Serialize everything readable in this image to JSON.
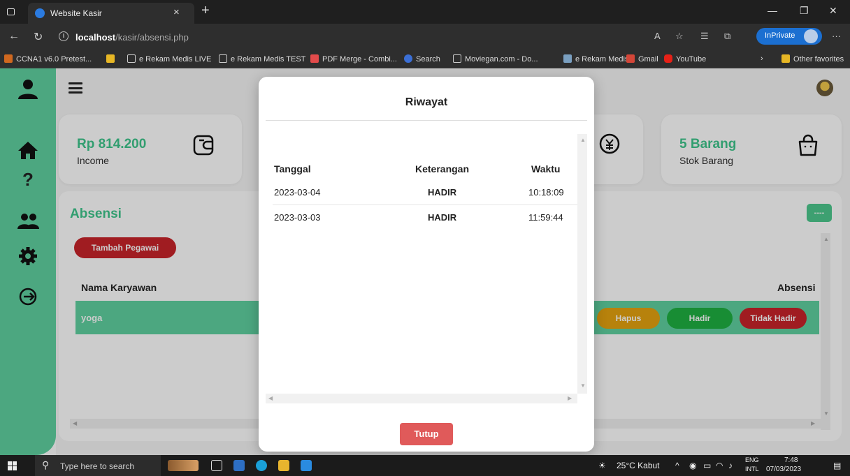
{
  "browser": {
    "tab_title": "Website Kasir",
    "tab_close": "×",
    "new_tab": "+",
    "url_host": "localhost",
    "url_path": "/kasir/absensi.php",
    "inprivate_label": "InPrivate",
    "bookmarks": [
      "CCNA1 v6.0 Pretest...",
      "e Rekam Medis LIVE",
      "e Rekam Medis TEST",
      "PDF Merge - Combi...",
      "Search",
      "Moviegan.com - Do...",
      "e Rekam Medis",
      "Gmail",
      "YouTube"
    ],
    "other_favorites": "Other favorites"
  },
  "cards": [
    {
      "value": "Rp 814.200",
      "label": "Income"
    },
    {
      "value": "5 Barang",
      "label": "Stok Barang"
    }
  ],
  "panel": {
    "title": "Absensi",
    "add_button": "Tambah Pegawai",
    "dash_button": "----",
    "col_name": "Nama Karyawan",
    "col_absensi": "Absensi",
    "row_name": "yoga",
    "btn_hapus": "Hapus",
    "btn_hadir": "Hadir",
    "btn_tidak_hadir": "Tidak Hadir"
  },
  "modal": {
    "title": "Riwayat",
    "headers": {
      "tanggal": "Tanggal",
      "keterangan": "Keterangan",
      "waktu": "Waktu"
    },
    "rows": [
      {
        "tanggal": "2023-03-04",
        "keterangan": "HADIR",
        "waktu": "10:18:09"
      },
      {
        "tanggal": "2023-03-03",
        "keterangan": "HADIR",
        "waktu": "11:59:44"
      }
    ],
    "close_button": "Tutup"
  },
  "taskbar": {
    "search_placeholder": "Type here to search",
    "weather": "25°C Kabut",
    "lang_top": "ENG",
    "lang_bottom": "INTL",
    "time": "7:48",
    "date": "07/03/2023"
  },
  "colors": {
    "accent_green": "#5fd1a0",
    "title_green": "#3fc68c",
    "red": "#c8242a",
    "orange": "#e5a30f",
    "green_button": "#1fb141",
    "close_red": "#e05a5a"
  }
}
